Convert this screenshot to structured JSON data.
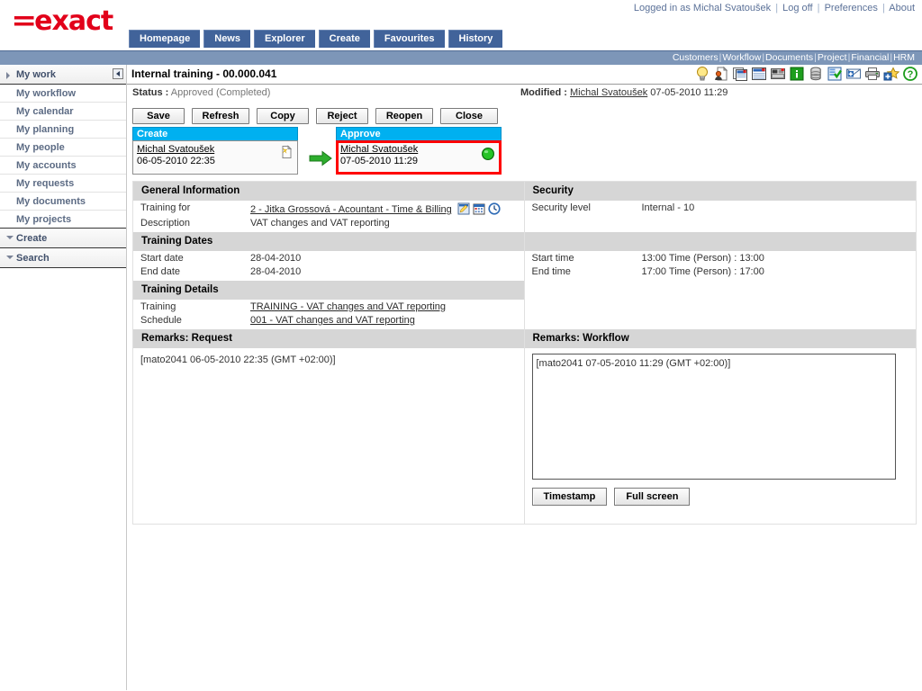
{
  "header": {
    "logo_text": "exact",
    "logo_prefix": "=",
    "session": {
      "logged_in_as": "Logged in as Michal Svatoušek",
      "log_off": "Log off",
      "preferences": "Preferences",
      "about": "About"
    },
    "nav_tabs": [
      {
        "label": "Homepage"
      },
      {
        "label": "News"
      },
      {
        "label": "Explorer"
      },
      {
        "label": "Create"
      },
      {
        "label": "Favourites"
      },
      {
        "label": "History"
      }
    ],
    "sub_nav": [
      {
        "label": "Customers"
      },
      {
        "label": "Workflow"
      },
      {
        "label": "Documents"
      },
      {
        "label": "Project"
      },
      {
        "label": "Financial"
      },
      {
        "label": "HRM"
      }
    ],
    "accent_blue": "#41639a",
    "subnav_blue": "#7d96b8",
    "logo_red": "#e2001a"
  },
  "sidebar": {
    "groups": [
      {
        "label": "My work",
        "expanded": true
      },
      {
        "label": "Create",
        "expanded": false
      },
      {
        "label": "Search",
        "expanded": false
      }
    ],
    "my_work_items": [
      {
        "label": "My workflow"
      },
      {
        "label": "My calendar"
      },
      {
        "label": "My planning"
      },
      {
        "label": "My people"
      },
      {
        "label": "My accounts"
      },
      {
        "label": "My requests"
      },
      {
        "label": "My documents"
      },
      {
        "label": "My projects"
      }
    ]
  },
  "page": {
    "title": "Internal training - 00.000.041",
    "status_label": "Status :",
    "status_value": "Approved (Completed)",
    "modified_label": "Modified :",
    "modified_user": "Michal Svatoušek",
    "modified_datetime": "07-05-2010 11:29",
    "toolbar_icons": [
      {
        "name": "lightbulb-icon"
      },
      {
        "name": "person-document-icon"
      },
      {
        "name": "copy-records-icon"
      },
      {
        "name": "list-details-icon"
      },
      {
        "name": "attachments-icon"
      },
      {
        "name": "info-icon"
      },
      {
        "name": "database-icon"
      },
      {
        "name": "checklist-icon"
      },
      {
        "name": "send-email-icon"
      },
      {
        "name": "print-icon"
      },
      {
        "name": "add-favourite-icon"
      },
      {
        "name": "help-icon"
      }
    ]
  },
  "action_buttons": [
    {
      "label": "Save",
      "name": "save-button"
    },
    {
      "label": "Refresh",
      "name": "refresh-button"
    },
    {
      "label": "Copy",
      "name": "copy-button"
    },
    {
      "label": "Reject",
      "name": "reject-button"
    },
    {
      "label": "Reopen",
      "name": "reopen-button"
    },
    {
      "label": "Close",
      "name": "close-button"
    }
  ],
  "workflow": {
    "steps": [
      {
        "header": "Create",
        "user": "Michal Svatoušek",
        "datetime": "06-05-2010 22:35",
        "icon": "new-document-icon",
        "highlighted": false
      },
      {
        "header": "Approve",
        "user": "Michal Svatoušek",
        "datetime": "07-05-2010 11:29",
        "icon": "green-status-ball-icon",
        "highlighted": true
      }
    ],
    "highlight_color": "#ff0000",
    "header_color": "#00b0f0"
  },
  "sections": {
    "general_information": {
      "title": "General Information",
      "fields": [
        {
          "label": "Training for",
          "value": "2 - Jitka Grossová - Acountant - Time & Billing",
          "is_link": true,
          "icons": [
            "edit-pencil-icon",
            "calendar-icon",
            "clock-icon"
          ]
        },
        {
          "label": "Description",
          "value": "VAT changes and VAT reporting",
          "is_link": false
        }
      ]
    },
    "security": {
      "title": "Security",
      "fields": [
        {
          "label": "Security level",
          "value": "Internal - 10",
          "is_link": false
        }
      ]
    },
    "training_dates_left": {
      "title": "Training Dates",
      "fields": [
        {
          "label": "Start date",
          "value": "28-04-2010"
        },
        {
          "label": "End date",
          "value": "28-04-2010"
        }
      ]
    },
    "training_dates_right": {
      "title": "",
      "fields": [
        {
          "label": "Start time",
          "value": "13:00 Time (Person) : 13:00"
        },
        {
          "label": "End time",
          "value": "17:00 Time (Person) : 17:00"
        }
      ]
    },
    "training_details": {
      "title": "Training Details",
      "fields": [
        {
          "label": "Training",
          "value": "TRAINING - VAT changes and VAT reporting",
          "is_link": true
        },
        {
          "label": "Schedule",
          "value": "001 - VAT changes and VAT reporting",
          "is_link": true
        }
      ]
    },
    "remarks_request": {
      "title": "Remarks: Request",
      "text": "[mato2041 06-05-2010 22:35 (GMT +02:00)]"
    },
    "remarks_workflow": {
      "title": "Remarks: Workflow",
      "textarea_value": "[mato2041 07-05-2010 11:29 (GMT +02:00)]",
      "buttons": [
        {
          "label": "Timestamp",
          "name": "timestamp-button"
        },
        {
          "label": "Full screen",
          "name": "full-screen-button"
        }
      ]
    }
  }
}
